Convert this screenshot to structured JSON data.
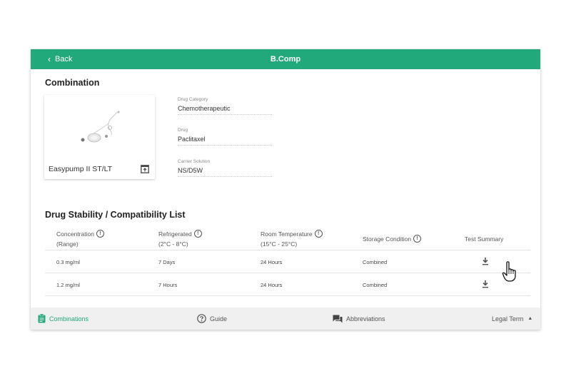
{
  "header": {
    "back_label": "Back",
    "title": "B.Comp"
  },
  "combination": {
    "section_title": "Combination",
    "product_name": "Easypump II ST/LT",
    "fields": [
      {
        "label": "Drug Category",
        "value": "Chemotherapeutic"
      },
      {
        "label": "Drug",
        "value": "Paclitaxel"
      },
      {
        "label": "Carrier Solution",
        "value": "NS/D5W"
      }
    ]
  },
  "stability": {
    "section_title": "Drug Stability / Compatibility List",
    "columns": [
      {
        "line1": "Concentration",
        "line2": "(Range)",
        "info": true
      },
      {
        "line1": "Refrigerated",
        "line2": "(2°C - 8°C)",
        "info": true
      },
      {
        "line1": "Room Temperature",
        "line2": "(15°C - 25°C)",
        "info": true
      },
      {
        "line1": "Storage Condition",
        "line2": "",
        "info": true
      },
      {
        "line1": "Test Summary",
        "line2": "",
        "info": false
      }
    ],
    "rows": [
      {
        "concentration": "0.3 mg/ml",
        "refrigerated": "7 Days",
        "room": "24 Hours",
        "storage": "Combined"
      },
      {
        "concentration": "1.2 mg/ml",
        "refrigerated": "7 Hours",
        "room": "24 Hours",
        "storage": "Combined"
      }
    ]
  },
  "bottom_nav": {
    "combinations": "Combinations",
    "guide": "Guide",
    "abbreviations": "Abbreviations",
    "legal": "Legal Term"
  },
  "colors": {
    "accent": "#21a87b",
    "bar": "#f0f0f0"
  },
  "icons": [
    "chevron-left-icon",
    "open-in-new-icon",
    "info-icon",
    "download-icon",
    "clipboard-icon",
    "help-circle-icon",
    "chat-icon",
    "caret-up-icon",
    "hand-cursor-icon"
  ]
}
